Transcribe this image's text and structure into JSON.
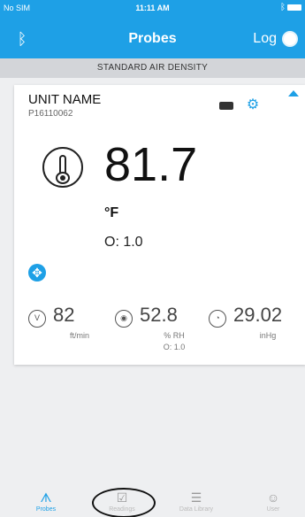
{
  "status_bar": {
    "carrier": "No SIM",
    "time": "11:11 AM"
  },
  "header": {
    "title": "Probes",
    "log_label": "Log"
  },
  "density_banner": "STANDARD AIR DENSITY",
  "probe_card": {
    "unit_name": "UNIT NAME",
    "serial": "P16110062",
    "primary": {
      "value": "81.7",
      "unit": "°F",
      "offset": "O: 1.0"
    },
    "metrics": [
      {
        "icon": "velocity-icon",
        "icon_text": "V",
        "value": "82",
        "unit": "ft/min",
        "offset": ""
      },
      {
        "icon": "humidity-icon",
        "icon_text": "◉",
        "value": "52.8",
        "unit": "% RH",
        "offset": "O: 1.0"
      },
      {
        "icon": "pressure-icon",
        "icon_text": "◔",
        "value": "29.02",
        "unit": "inHg",
        "offset": ""
      }
    ]
  },
  "tabs": [
    {
      "label": "Probes",
      "icon": "probe-icon",
      "active": true
    },
    {
      "label": "Readings",
      "icon": "clipboard-icon",
      "active": false
    },
    {
      "label": "Data Library",
      "icon": "library-icon",
      "active": false
    },
    {
      "label": "User",
      "icon": "user-icon",
      "active": false
    }
  ],
  "colors": {
    "accent": "#1ea0e6",
    "banner": "#d3d5d9",
    "background": "#eeeff1"
  }
}
